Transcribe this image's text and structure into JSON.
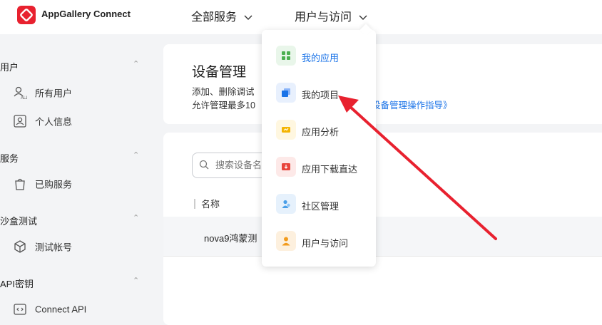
{
  "header": {
    "app_name": "AppGallery Connect",
    "nav": [
      {
        "label": "全部服务"
      },
      {
        "label": "用户与访问"
      }
    ]
  },
  "sidebar": {
    "groups": [
      {
        "title": "用户",
        "items": [
          {
            "label": "所有用户",
            "icon": "all-users-icon"
          },
          {
            "label": "个人信息",
            "icon": "profile-card-icon"
          }
        ]
      },
      {
        "title": "服务",
        "items": [
          {
            "label": "已购服务",
            "icon": "shopping-bag-icon"
          }
        ]
      },
      {
        "title": "沙盒测试",
        "items": [
          {
            "label": "测试帐号",
            "icon": "cube-icon"
          }
        ]
      },
      {
        "title": "API密钥",
        "items": [
          {
            "label": "Connect API",
            "icon": "code-icon"
          }
        ]
      }
    ]
  },
  "main": {
    "title": "设备管理",
    "desc_line1": "添加、删除调试",
    "desc_line2": "允许管理最多10",
    "desc_link": "设备管理操作指导》",
    "search_placeholder": "搜索设备名",
    "column_header": "名称",
    "row_name": "nova9鸿蒙测"
  },
  "dropdown": {
    "items": [
      {
        "label": "我的应用",
        "icon": "apps-grid-icon",
        "color": "#4caf50"
      },
      {
        "label": "我的项目",
        "icon": "project-stack-icon",
        "color": "#1a73e8"
      },
      {
        "label": "应用分析",
        "icon": "analytics-icon",
        "color": "#f4b400"
      },
      {
        "label": "应用下载直达",
        "icon": "download-direct-icon",
        "color": "#e8453c"
      },
      {
        "label": "社区管理",
        "icon": "community-icon",
        "color": "#4a9fe8"
      },
      {
        "label": "用户与访问",
        "icon": "user-access-icon",
        "color": "#f29b1d"
      }
    ]
  },
  "colors": {
    "accent": "#1a73e8",
    "brand": "#e8212f",
    "annotation": "#e8212f"
  }
}
